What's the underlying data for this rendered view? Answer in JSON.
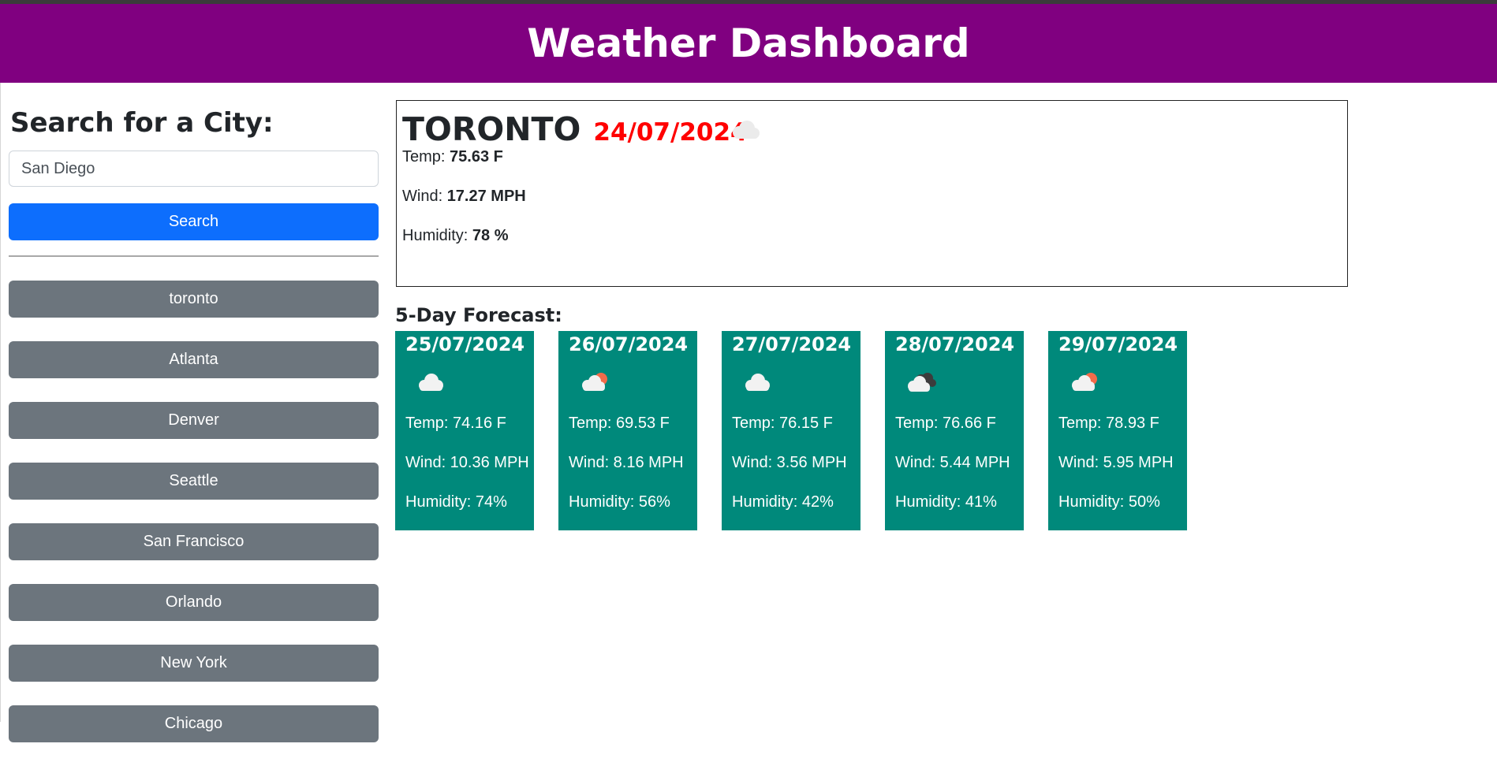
{
  "header": {
    "title": "Weather Dashboard"
  },
  "sidebar": {
    "heading": "Search for a City:",
    "search_value": "San Diego",
    "search_button": "Search",
    "history": [
      "toronto",
      "Atlanta",
      "Denver",
      "Seattle",
      "San Francisco",
      "Orlando",
      "New York",
      "Chicago"
    ]
  },
  "current": {
    "city": "TORONTO",
    "date": "24/07/2024",
    "icon": "cloud-icon",
    "temp_label": "Temp:",
    "temp_value": "75.63 F",
    "wind_label": "Wind:",
    "wind_value": "17.27 MPH",
    "humidity_label": "Humidity:",
    "humidity_value": "78 %"
  },
  "forecast": {
    "title": "5-Day Forecast:",
    "days": [
      {
        "date": "25/07/2024",
        "icon": "cloud-icon",
        "temp": "Temp: 74.16 F",
        "wind": "Wind: 10.36 MPH",
        "humidity": "Humidity: 74%"
      },
      {
        "date": "26/07/2024",
        "icon": "partly-cloudy-sun-icon",
        "temp": "Temp: 69.53 F",
        "wind": "Wind: 8.16 MPH",
        "humidity": "Humidity: 56%"
      },
      {
        "date": "27/07/2024",
        "icon": "cloud-icon",
        "temp": "Temp: 76.15 F",
        "wind": "Wind: 3.56 MPH",
        "humidity": "Humidity: 42%"
      },
      {
        "date": "28/07/2024",
        "icon": "broken-clouds-icon",
        "temp": "Temp: 76.66 F",
        "wind": "Wind: 5.44 MPH",
        "humidity": "Humidity: 41%"
      },
      {
        "date": "29/07/2024",
        "icon": "partly-cloudy-sun-icon",
        "temp": "Temp: 78.93 F",
        "wind": "Wind: 5.95 MPH",
        "humidity": "Humidity: 50%"
      }
    ]
  },
  "colors": {
    "header_bg": "#800080",
    "primary": "#0d6efd",
    "history_bg": "#6c757d",
    "forecast_bg": "#00897b",
    "date_red": "#ff0000"
  }
}
